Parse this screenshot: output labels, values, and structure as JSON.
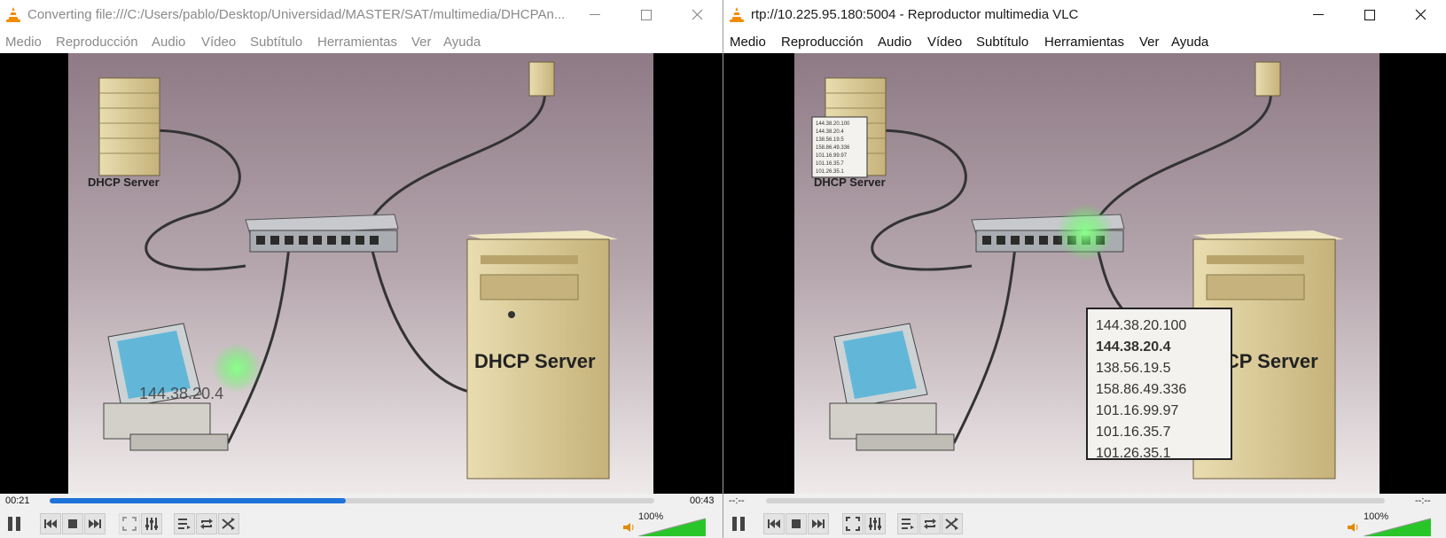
{
  "colors": {
    "accent": "#1e73d8",
    "volume": "#29c629",
    "glow": "#4dff4d"
  },
  "left_window": {
    "title": "Converting file:///C:/Users/pablo/Desktop/Universidad/MASTER/SAT/multimedia/DHCPAn...",
    "menu": [
      "Medio",
      "Reproducción",
      "Audio",
      "Vídeo",
      "Subtítulo",
      "Herramientas",
      "Ver",
      "Ayuda"
    ],
    "video": {
      "server_label_small": "DHCP Server",
      "server_label_large": "DHCP Server",
      "ip_overlay": "144.38.20.4"
    },
    "time_elapsed": "00:21",
    "time_total": "00:43",
    "progress": 0.49,
    "volume_label": "100%",
    "volume": 1.0
  },
  "right_window": {
    "title": "rtp://10.225.95.180:5004 - Reproductor multimedia VLC",
    "menu": [
      "Medio",
      "Reproducción",
      "Audio",
      "Vídeo",
      "Subtítulo",
      "Herramientas",
      "Ver",
      "Ayuda"
    ],
    "video": {
      "server_label_small": "DHCP Server",
      "server_label_large": "HCP Server",
      "small_ip_list": [
        "144.38.20.100",
        "144.38.20.4",
        "138.56.19.5",
        "158.86.49.336",
        "101.16.99.97",
        "101.16.35.7",
        "101.26.35.1"
      ],
      "ip_list": [
        "144.38.20.100",
        "144.38.20.4",
        "138.56.19.5",
        "158.86.49.336",
        "101.16.99.97",
        "101.16.35.7",
        "101.26.35.1"
      ]
    },
    "time_elapsed": "--:--",
    "time_total": "--:--",
    "progress": 0,
    "volume_label": "100%",
    "volume": 1.0
  },
  "icons": [
    "vlc-cone-icon",
    "minimize-icon",
    "maximize-icon",
    "close-icon",
    "pause-icon",
    "previous-icon",
    "stop-icon",
    "next-icon",
    "fullscreen-icon",
    "extended-settings-icon",
    "playlist-icon",
    "loop-icon",
    "shuffle-icon",
    "speaker-icon"
  ]
}
